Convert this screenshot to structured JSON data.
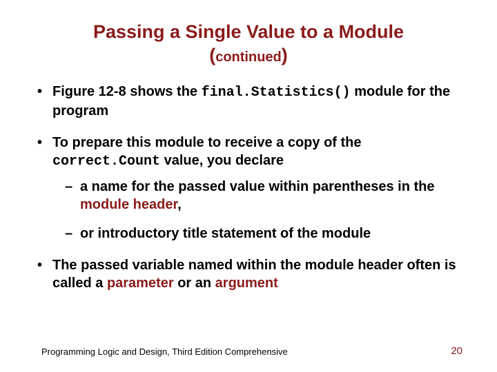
{
  "title": {
    "main": "Passing a Single Value to a Module",
    "sub_open": "(",
    "sub_text": "continued",
    "sub_close": ")"
  },
  "bullets": {
    "b1_a": "Figure 12-8 shows the ",
    "b1_code": "final.Statistics()",
    "b1_b": " module for the program",
    "b2_a": "To prepare this module to receive a copy of the ",
    "b2_code": "correct.Count",
    "b2_b": " value, you declare",
    "b2_s1_a": "a name for the passed value within parentheses in the ",
    "b2_s1_hl": "module header",
    "b2_s1_b": ",",
    "b2_s2": "or introductory title statement of the module",
    "b3_a": "The passed variable named within the module header often is called a ",
    "b3_hl1": "parameter",
    "b3_mid": " or an ",
    "b3_hl2": "argument"
  },
  "footer": {
    "text": "Programming Logic and Design, Third Edition Comprehensive",
    "page": "20"
  }
}
